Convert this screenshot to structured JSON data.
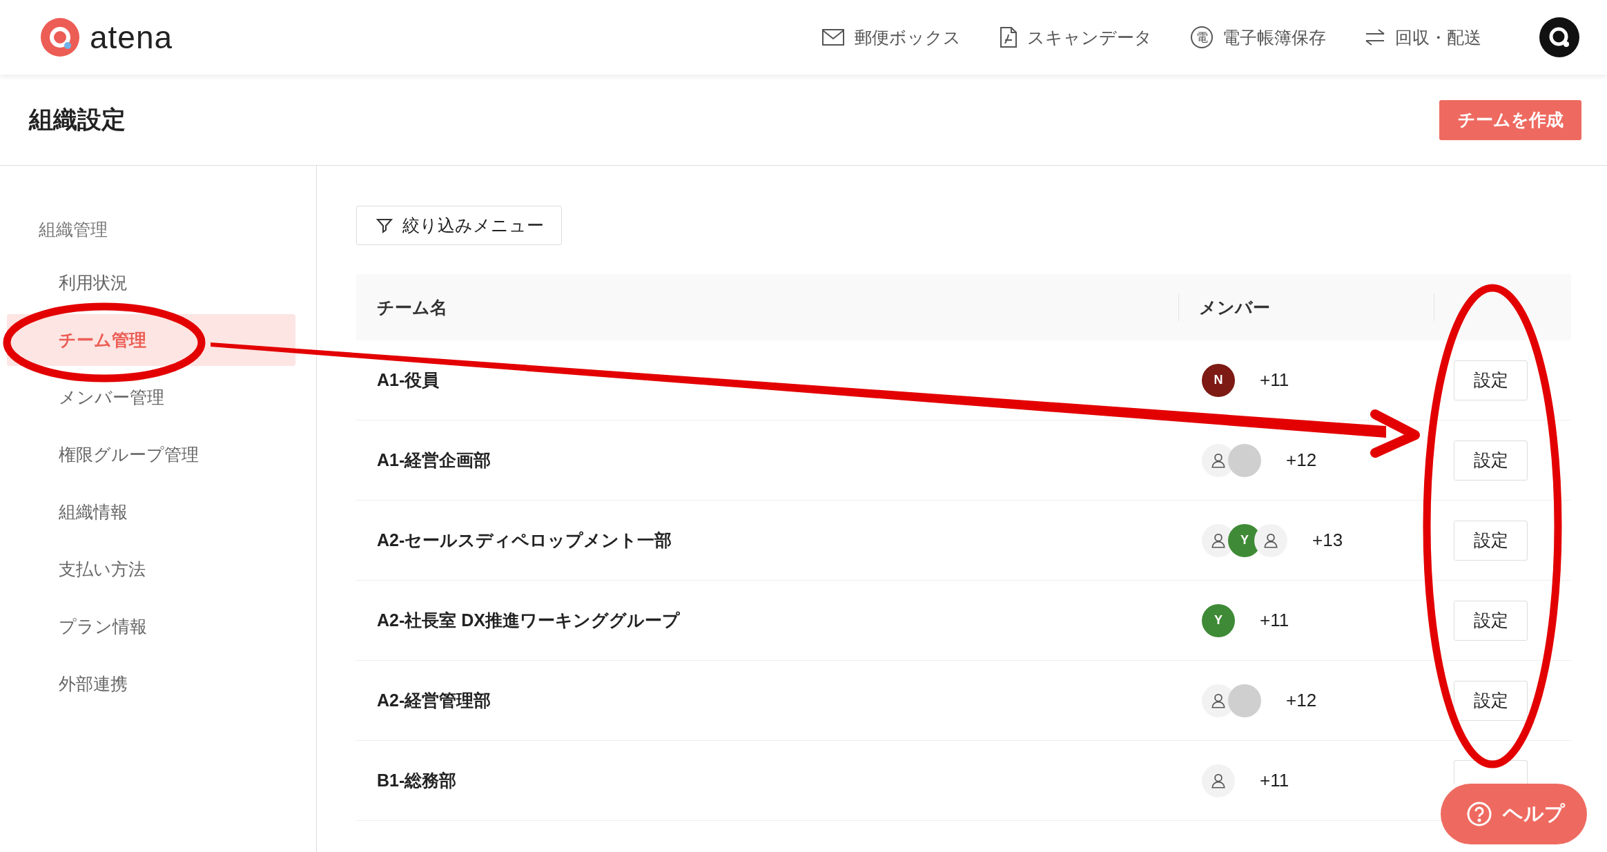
{
  "header": {
    "logo_text": "atena",
    "nav": [
      {
        "label": "郵便ボックス",
        "kind": "mail"
      },
      {
        "label": "スキャンデータ",
        "kind": "document"
      },
      {
        "label": "電子帳簿保存",
        "kind": "badge",
        "icon_text": "電"
      },
      {
        "label": "回収・配送",
        "kind": "swap"
      }
    ]
  },
  "page": {
    "title": "組織設定",
    "create_button": "チームを作成"
  },
  "sidebar": {
    "section": "組織管理",
    "items": [
      {
        "label": "利用状況",
        "selected": false
      },
      {
        "label": "チーム管理",
        "selected": true
      },
      {
        "label": "メンバー管理",
        "selected": false
      },
      {
        "label": "権限グループ管理",
        "selected": false
      },
      {
        "label": "組織情報",
        "selected": false
      },
      {
        "label": "支払い方法",
        "selected": false
      },
      {
        "label": "プラン情報",
        "selected": false
      },
      {
        "label": "外部連携",
        "selected": false
      }
    ]
  },
  "filter_button": "絞り込みメニュー",
  "table": {
    "columns": [
      "チーム名",
      "メンバー"
    ],
    "rows": [
      {
        "name": "A1-役員",
        "members": [
          {
            "kind": "initial",
            "text": "N",
            "color": "#7d1a14"
          }
        ],
        "count": "+11",
        "action": "設定"
      },
      {
        "name": "A1-経営企画部",
        "members": [
          {
            "kind": "person"
          },
          {
            "kind": "blank"
          }
        ],
        "count": "+12",
        "action": "設定"
      },
      {
        "name": "A2-セールスディペロップメント一部",
        "members": [
          {
            "kind": "person"
          },
          {
            "kind": "initial",
            "text": "Y",
            "color": "#3f8a36"
          },
          {
            "kind": "person"
          }
        ],
        "count": "+13",
        "action": "設定"
      },
      {
        "name": "A2-社長室 DX推進ワーキンググループ",
        "members": [
          {
            "kind": "initial",
            "text": "Y",
            "color": "#3f8a36"
          }
        ],
        "count": "+11",
        "action": "設定"
      },
      {
        "name": "A2-経営管理部",
        "members": [
          {
            "kind": "person"
          },
          {
            "kind": "blank"
          }
        ],
        "count": "+12",
        "action": "設定"
      },
      {
        "name": "B1-総務部",
        "members": [
          {
            "kind": "person"
          }
        ],
        "count": "+11"
      }
    ]
  },
  "help_button": "ヘルプ",
  "annotations": [
    {
      "kind": "ellipse"
    },
    {
      "kind": "arrow"
    },
    {
      "kind": "ellipse"
    }
  ]
}
